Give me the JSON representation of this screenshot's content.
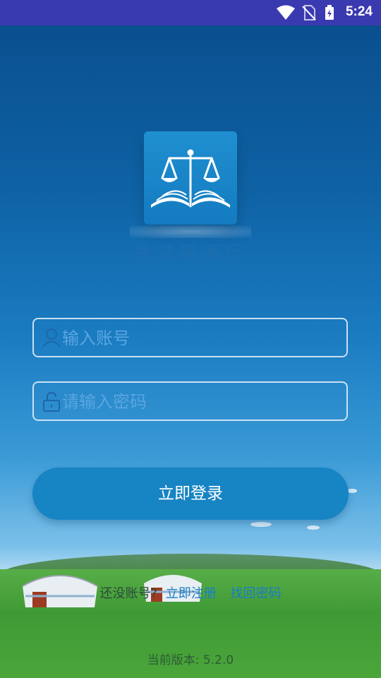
{
  "status_bar": {
    "time": "5:24",
    "background": "#3a3ab0"
  },
  "app": {
    "name": "执法易通行",
    "logo_icon": "scales-book-icon"
  },
  "login": {
    "account_placeholder": "输入账号",
    "password_placeholder": "请输入密码",
    "account_icon": "user-icon",
    "password_icon": "lock-icon",
    "button_label": "立即登录"
  },
  "footer": {
    "no_account": "还没账号?",
    "register": "立即注册",
    "forgot": "找回密码",
    "version": "当前版本: 5.2.0"
  },
  "colors": {
    "accent": "#1784c3",
    "link": "#1a7dc6"
  }
}
